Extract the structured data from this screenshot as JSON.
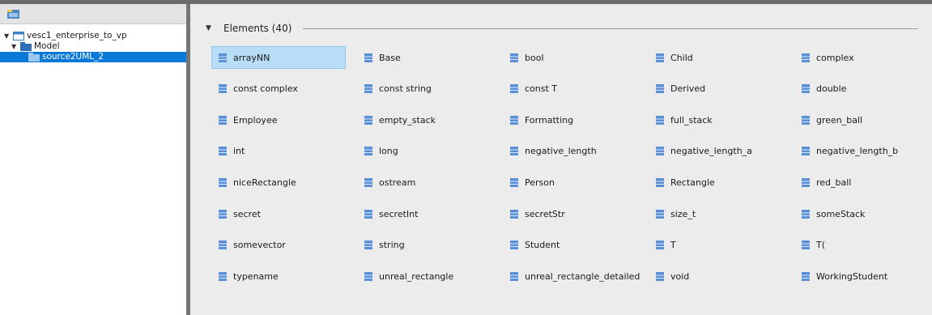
{
  "tree": {
    "toolbar_icon": "package-explorer-icon",
    "items": [
      {
        "label": "vesc1_enterprise_to_vp",
        "icon": "project-icon",
        "expanded": true,
        "selected": false
      },
      {
        "label": "Model",
        "icon": "folder-icon",
        "expanded": true,
        "selected": false
      },
      {
        "label": "source2UML_2",
        "icon": "folder-icon",
        "expanded": false,
        "selected": true
      }
    ]
  },
  "section": {
    "title": "Elements (40)",
    "icon": "collapse-arrow-icon"
  },
  "elements": [
    "arrayNN",
    "Base",
    "bool",
    "Child",
    "complex",
    "const complex",
    "const string",
    "const T",
    "Derived",
    "double",
    "Employee",
    "empty_stack",
    "Formatting",
    "full_stack",
    "green_ball",
    "int",
    "long",
    "negative_length",
    "negative_length_a",
    "negative_length_b",
    "niceRectangle",
    "ostream",
    "Person",
    "Rectangle",
    "red_ball",
    "secret",
    "secretInt",
    "secretStr",
    "size_t",
    "someStack",
    "somevector",
    "string",
    "Student",
    "T",
    "T(",
    "typename",
    "unreal_rectangle",
    "unreal_rectangle_detailed",
    "void",
    "WorkingStudent"
  ],
  "selected_element": "arrayNN",
  "colors": {
    "selection_blue": "#0a78d7",
    "cell_selected": "#b8ddf6",
    "class_icon": "#5b8fd6",
    "panel_bg": "#ececec"
  }
}
